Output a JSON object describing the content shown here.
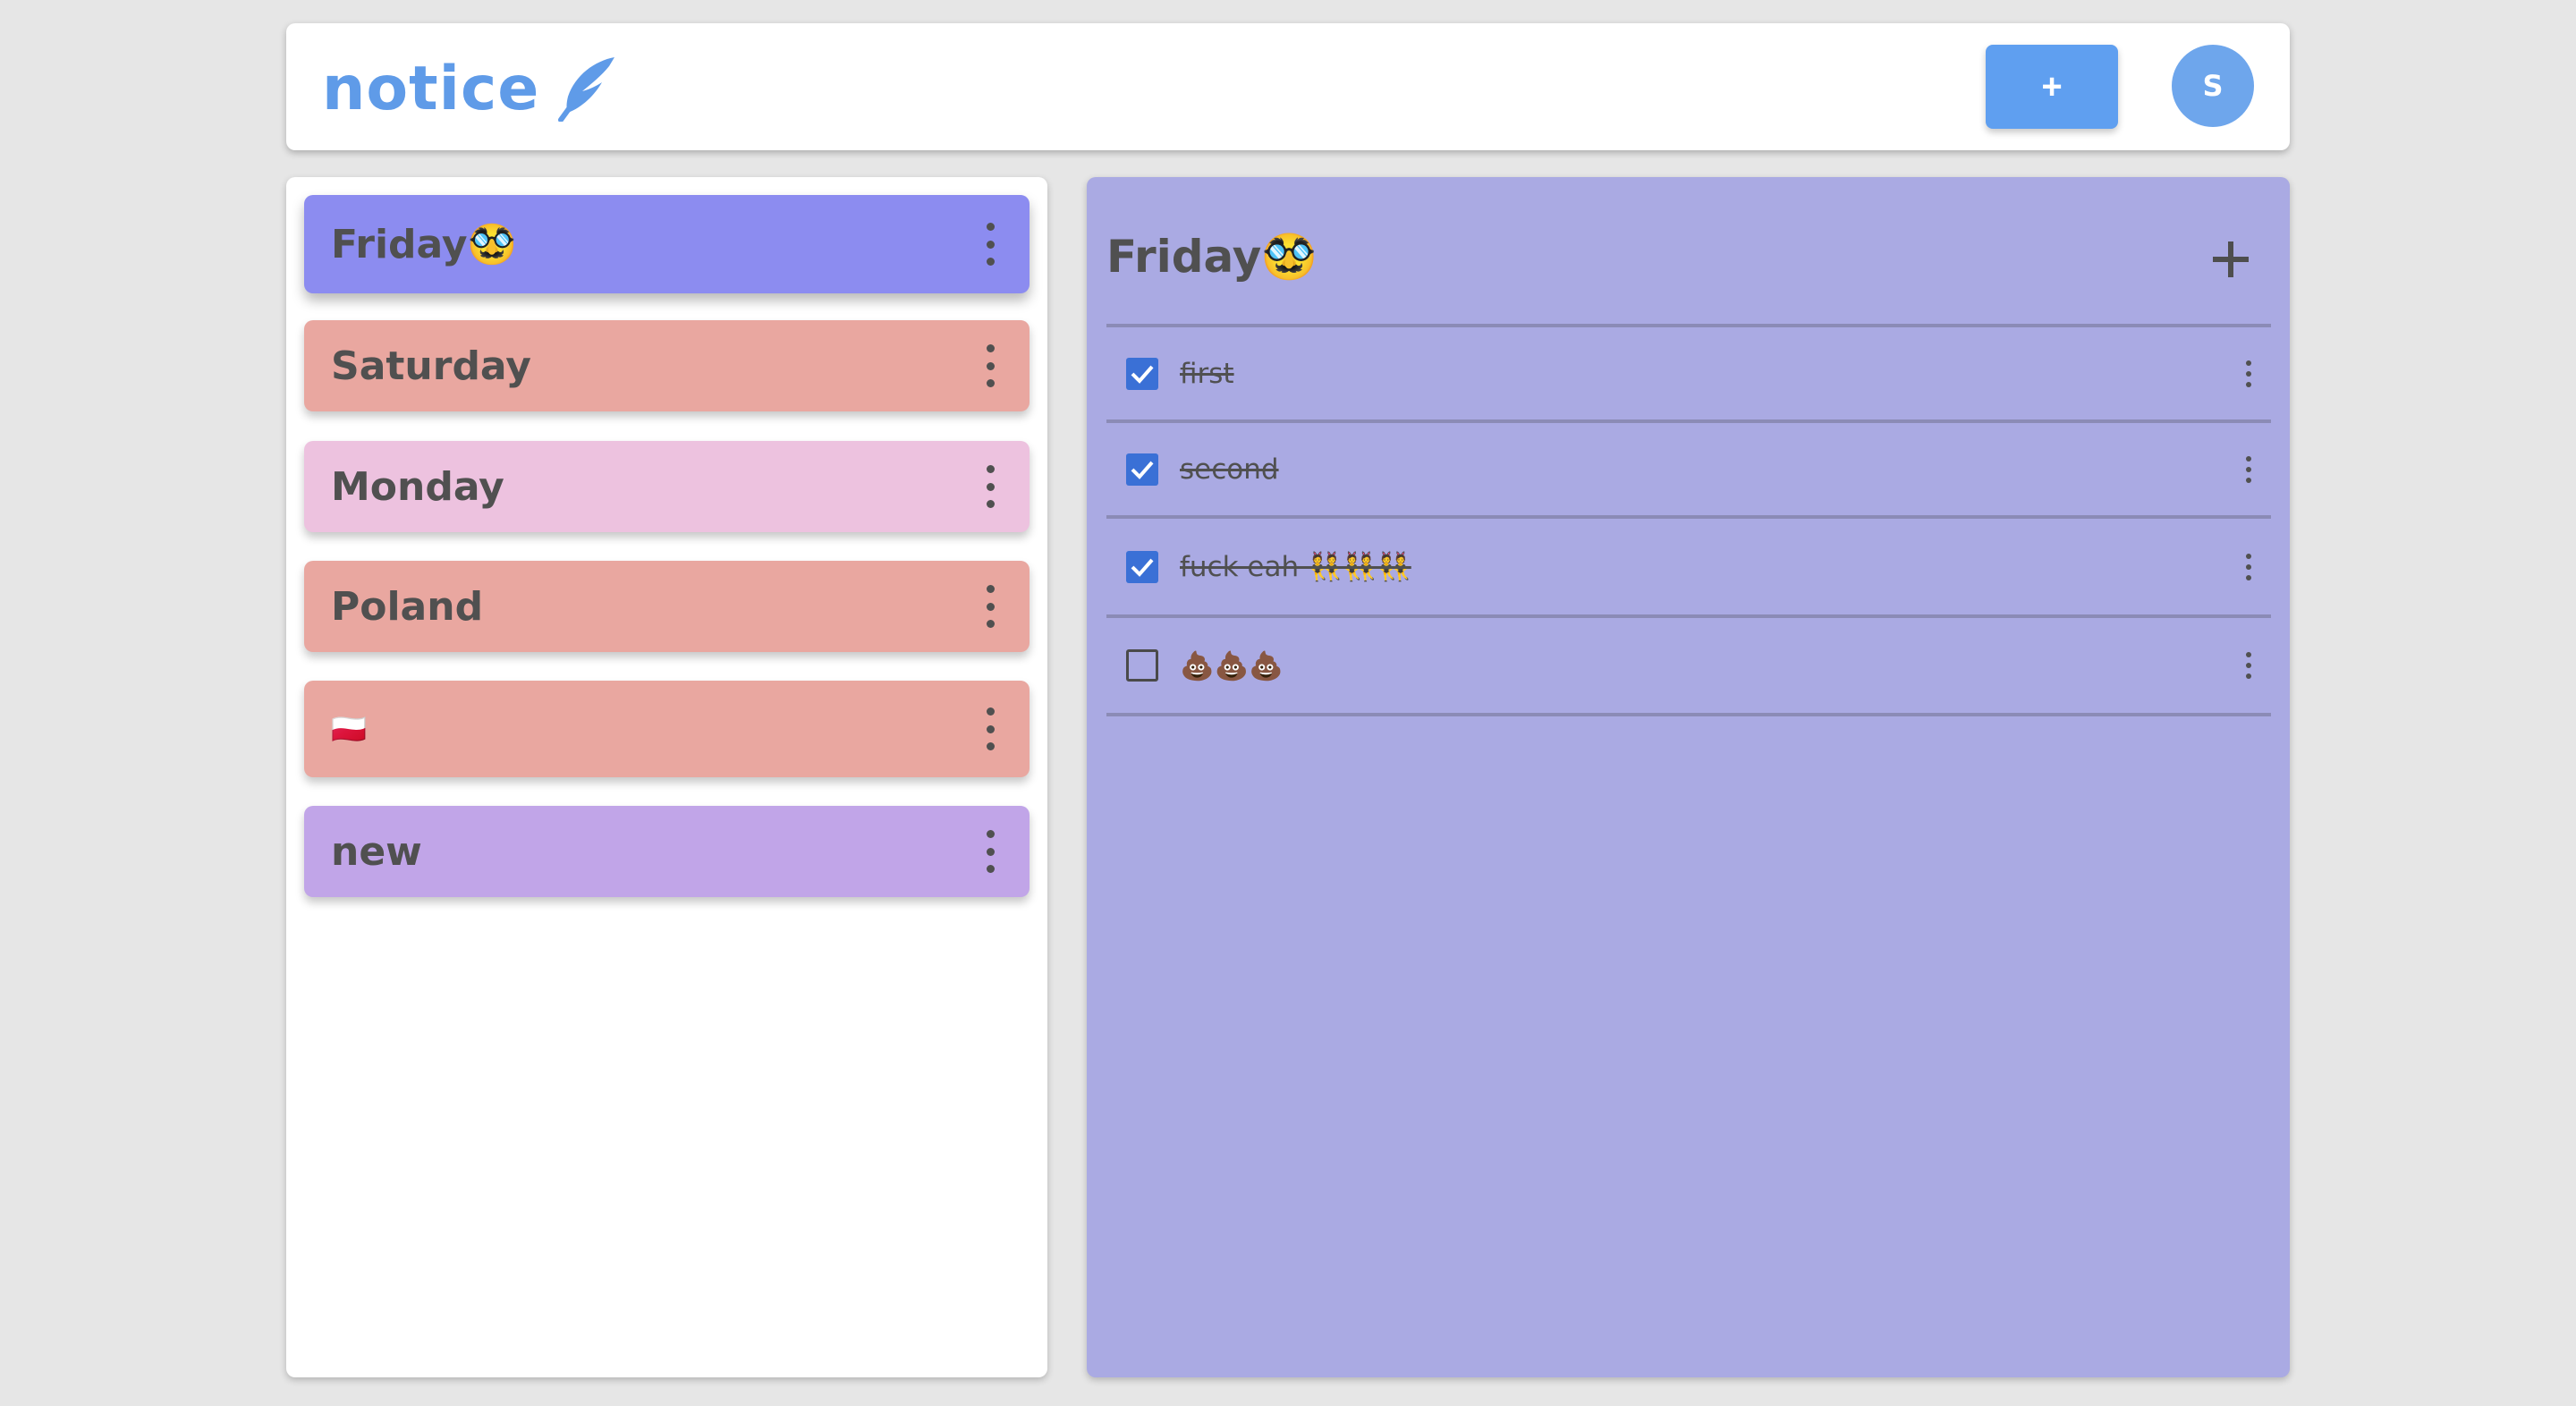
{
  "app": {
    "logo_text": "notice",
    "logo_icon": "feather-icon",
    "add_label": "+",
    "avatar_initial": "S"
  },
  "colors": {
    "accent": "#5f9ff0",
    "logo": "#5f9be8",
    "detail_bg": "#aaaae3",
    "checkbox": "#3a70d6"
  },
  "notes": [
    {
      "label": "Friday🥸",
      "color": "#8c8cf0",
      "selected": true
    },
    {
      "label": "Saturday",
      "color": "#e9a7a0"
    },
    {
      "label": "Monday",
      "color": "#edc2df"
    },
    {
      "label": "Poland",
      "color": "#e9a7a0"
    },
    {
      "label": "🇵🇱",
      "color": "#e9a7a0"
    },
    {
      "label": "new",
      "color": "#c1a5e8"
    }
  ],
  "detail": {
    "title": "Friday🥸",
    "add_icon": "plus-icon",
    "todos": [
      {
        "text": "first",
        "done": true
      },
      {
        "text": "second",
        "done": true
      },
      {
        "text": "fuck eah 👯👯👯",
        "done": true
      },
      {
        "text": "💩💩💩",
        "done": false
      }
    ]
  }
}
